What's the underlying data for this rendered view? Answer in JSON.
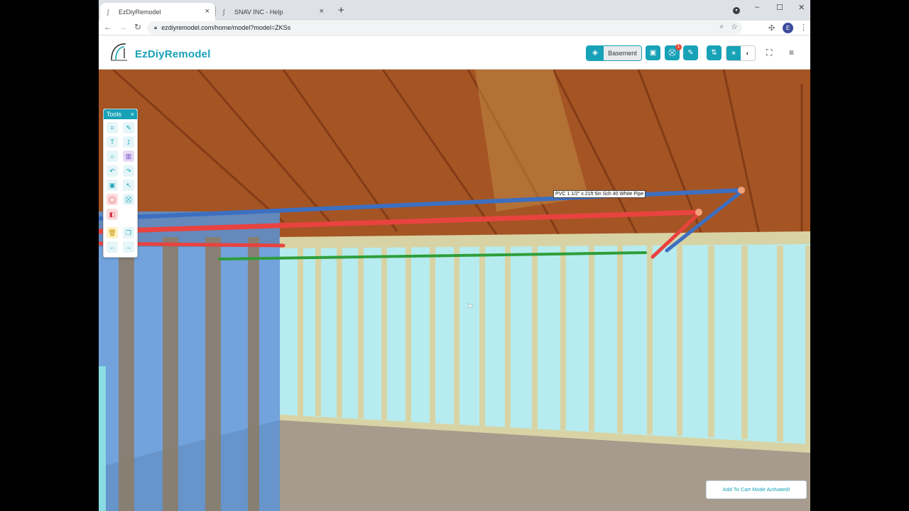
{
  "browser": {
    "tabs": [
      {
        "title": "EzDiyRemodel",
        "active": true
      },
      {
        "title": "SNAV INC - Help",
        "active": false
      }
    ],
    "new_tab_label": "+",
    "url": "ezdiyremodel.com/home/model?model=ZKSs",
    "profile_initial": "E",
    "window_controls": {
      "minimize": "–",
      "maximize": "☐",
      "close": "✕"
    }
  },
  "app": {
    "name": "EzDiyRemodel",
    "floor_label": "Basement",
    "cart_count": "1",
    "accent_color": "#17a2b8"
  },
  "tools_panel": {
    "title": "Tools",
    "close_glyph": "×"
  },
  "viewport": {
    "hover_tooltip": "PVC 1 1/2\" x 21ft 5in Sch 40 White Pipe",
    "pipe_colors": {
      "hot": "#e8433f",
      "cold": "#3d6fc0",
      "drain": "#2e9e3a"
    }
  },
  "toast": {
    "message": "Add To Cart Mode Activated!"
  }
}
